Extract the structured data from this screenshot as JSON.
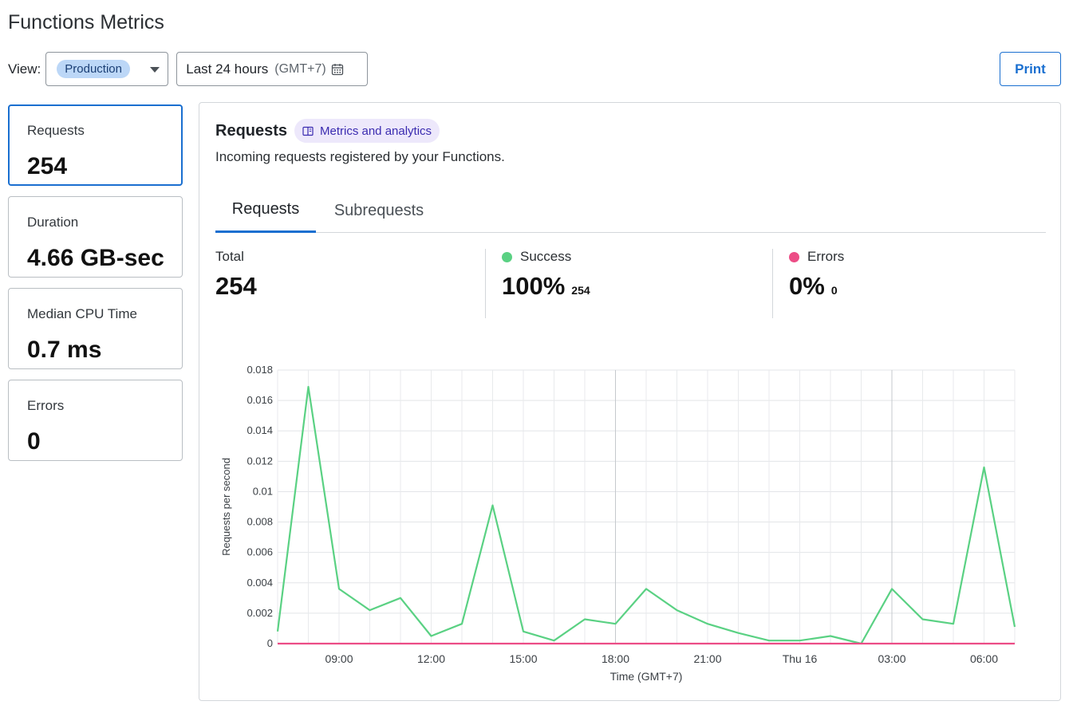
{
  "page": {
    "title": "Functions Metrics"
  },
  "toolbar": {
    "view_label": "View:",
    "environment": "Production",
    "date_range": "Last 24 hours",
    "timezone": "(GMT+7)",
    "print_label": "Print"
  },
  "cards": [
    {
      "label": "Requests",
      "value": "254",
      "active": true
    },
    {
      "label": "Duration",
      "value": "4.66 GB-sec",
      "active": false
    },
    {
      "label": "Median CPU Time",
      "value": "0.7 ms",
      "active": false
    },
    {
      "label": "Errors",
      "value": "0",
      "active": false
    }
  ],
  "panel": {
    "title": "Requests",
    "doc_link": "Metrics and analytics",
    "description": "Incoming requests registered by your Functions.",
    "tabs": [
      {
        "label": "Requests",
        "active": true
      },
      {
        "label": "Subrequests",
        "active": false
      }
    ],
    "stats": {
      "total": {
        "label": "Total",
        "value": "254"
      },
      "success": {
        "label": "Success",
        "value": "100%",
        "count": "254",
        "color": "#5ad183"
      },
      "errors": {
        "label": "Errors",
        "value": "0%",
        "count": "0",
        "color": "#ec4d86"
      }
    }
  },
  "chart_data": {
    "type": "line",
    "ylabel": "Requests per second",
    "xlabel": "Time (GMT+7)",
    "ylim": [
      0,
      0.018
    ],
    "yticks": [
      "0",
      "0.002",
      "0.004",
      "0.006",
      "0.008",
      "0.01",
      "0.012",
      "0.014",
      "0.016",
      "0.018"
    ],
    "xticks": [
      "09:00",
      "12:00",
      "15:00",
      "18:00",
      "21:00",
      "Thu 16",
      "03:00",
      "06:00"
    ],
    "xtick_hours": [
      9,
      12,
      15,
      18,
      21,
      24,
      27,
      30
    ],
    "xlim_hours": [
      7,
      31
    ],
    "major_gridline_hours": [
      18,
      27
    ],
    "grid": true,
    "series": [
      {
        "color": "#5ad183",
        "x_hours": [
          7,
          8,
          9,
          10,
          11,
          12,
          13,
          14,
          15,
          16,
          17,
          18,
          19,
          20,
          21,
          22,
          23,
          24,
          25,
          26,
          27,
          28,
          29,
          30,
          31
        ],
        "values": [
          0.0008,
          0.0169,
          0.0036,
          0.0022,
          0.003,
          0.0005,
          0.0013,
          0.0091,
          0.0008,
          0.0002,
          0.0016,
          0.0013,
          0.0036,
          0.0022,
          0.0013,
          0.0007,
          0.0002,
          0.0002,
          0.0005,
          0.0,
          0.0036,
          0.0016,
          0.0013,
          0.0116,
          0.0011
        ]
      },
      {
        "color": "#ec4d86",
        "x_hours": [
          7,
          31
        ],
        "values": [
          0,
          0
        ]
      }
    ]
  }
}
